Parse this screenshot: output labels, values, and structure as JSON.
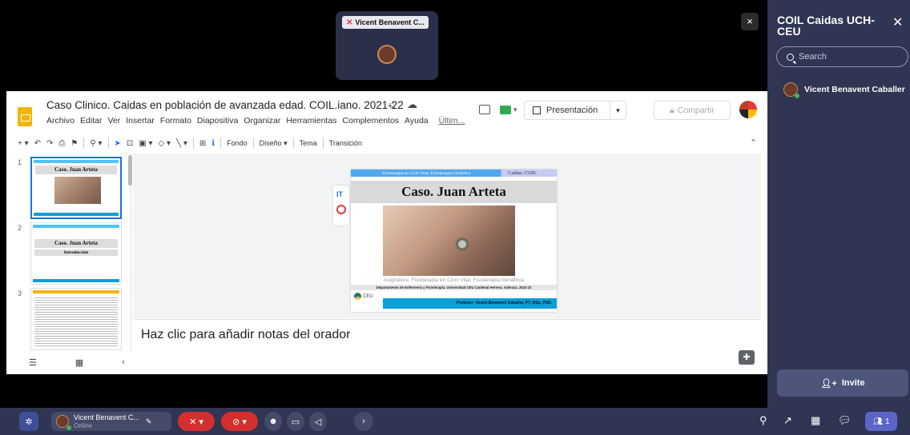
{
  "meeting": {
    "tile_name": "Vicent Benavent C...",
    "close_label": "×"
  },
  "slides_app": {
    "doc_title": "Caso Clinico. Caidas en población de avanzada edad. COIL.iano. 2021-22",
    "star": "☆",
    "cloud": "☁",
    "menus": [
      "Archivo",
      "Editar",
      "Ver",
      "Insertar",
      "Formato",
      "Diapositiva",
      "Organizar",
      "Herramientas",
      "Complementos",
      "Ayuda"
    ],
    "last_edit": "Últim...",
    "present_label": "Presentación",
    "share_label": "Compartir",
    "toolbar": {
      "fondo": "Fondo",
      "diseno": "Diseño ▾",
      "tema": "Tema",
      "transicion": "Transición"
    },
    "filmstrip": [
      {
        "num": "1",
        "title": "Caso. Juan Arteta",
        "subtitle": ""
      },
      {
        "num": "2",
        "title": "Caso. Juan Arteta",
        "subtitle": "Introducción"
      },
      {
        "num": "3",
        "title": "",
        "subtitle": ""
      }
    ],
    "slide": {
      "top_left": "Fisioterapia en Ciclo Vital. Fisioterapia Geriátrica",
      "top_right": "Caidas. COIL",
      "title": "Caso. Juan Arteta",
      "subject": "Asignatura: Fisioterapia en Ciclo Vital. Fisioterapia Geriátrica",
      "department": "Departamento de Enfermería y Fisioterapia. Universidad CEU Cardenal Herrera. Valencia. 2022-23",
      "logo_text": "CEU",
      "professor": "Profesor: Vicent Benavent Caballer, PT, MSc, PhD."
    },
    "notes_placeholder": "Haz clic para añadir notas del orador"
  },
  "chat_panel": {
    "title": "COIL Caidas UCH-CEU",
    "search_placeholder": "Search",
    "members": [
      {
        "name": "Vicent Benavent Caballer"
      }
    ],
    "invite_label": "Invite"
  },
  "bottom_bar": {
    "user_name": "Vicent Benavent C...",
    "user_status": "Online",
    "people_count": "1"
  },
  "colors": {
    "panel_bg": "#2f3553",
    "mute_red": "#d32f2f",
    "accent_blue": "#1a73e8",
    "slide_banner": "#0aa0d8"
  }
}
